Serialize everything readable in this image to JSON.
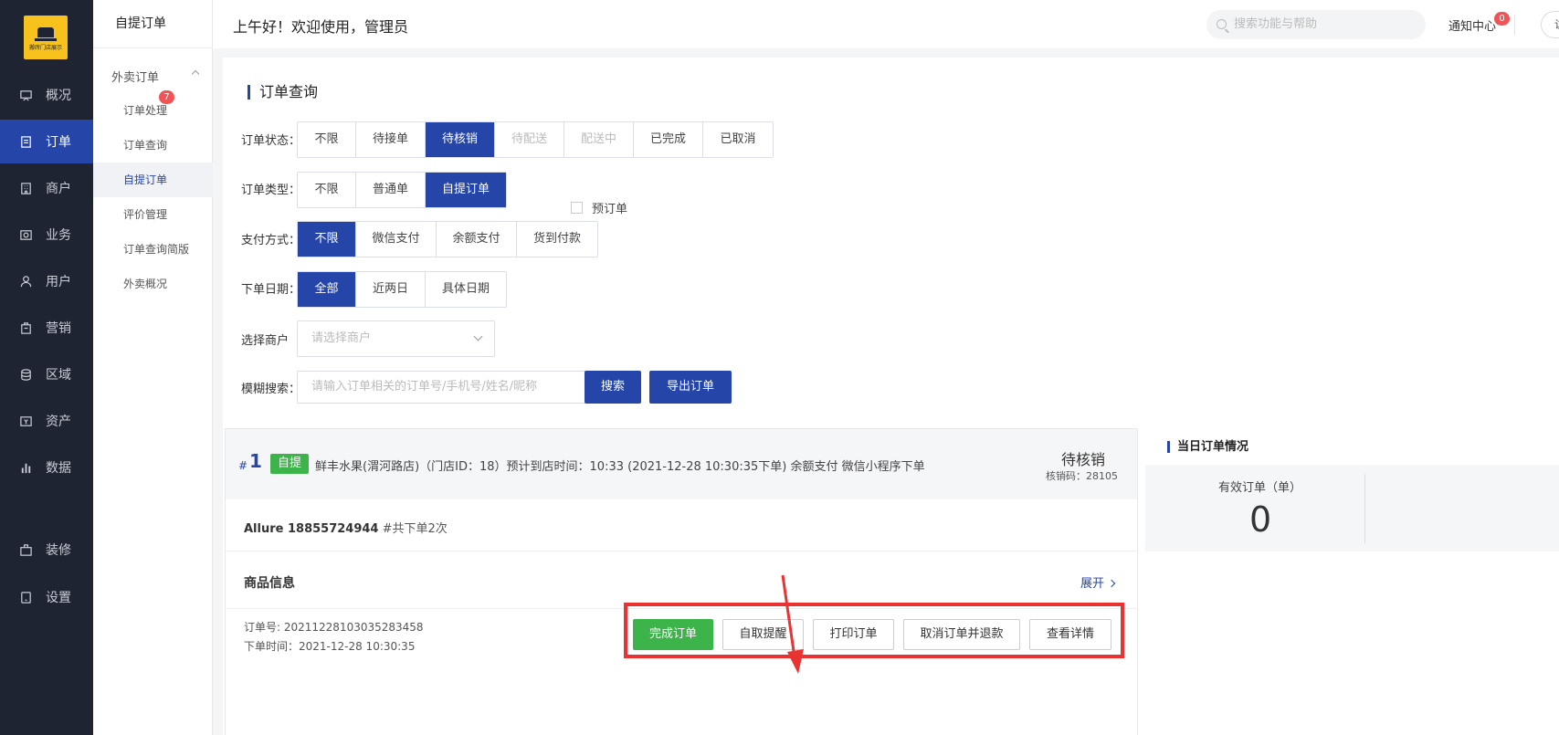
{
  "nav": {
    "logo_text": "搬砖门店展示",
    "items": [
      {
        "label": "概况",
        "icon": "dashboard-icon"
      },
      {
        "label": "订单",
        "icon": "order-icon"
      },
      {
        "label": "商户",
        "icon": "merchant-icon"
      },
      {
        "label": "业务",
        "icon": "business-icon"
      },
      {
        "label": "用户",
        "icon": "user-icon"
      },
      {
        "label": "营销",
        "icon": "marketing-icon"
      },
      {
        "label": "区域",
        "icon": "region-icon"
      },
      {
        "label": "资产",
        "icon": "asset-icon"
      },
      {
        "label": "数据",
        "icon": "data-icon"
      },
      {
        "label": "装修",
        "icon": "decorate-icon"
      },
      {
        "label": "设置",
        "icon": "settings-icon"
      }
    ]
  },
  "subnav": {
    "header": "自提订单",
    "group": "外卖订单",
    "badge": "7",
    "items": [
      "订单处理",
      "订单查询",
      "自提订单",
      "评价管理",
      "订单查询简版",
      "外卖概况"
    ]
  },
  "topbar": {
    "greeting": "上午好！欢迎使用，管理员",
    "search_placeholder": "搜索功能与帮助",
    "notice": "通知中心",
    "notice_count": "0",
    "visit": "访"
  },
  "query": {
    "title": "订单查询",
    "status_label": "订单状态：",
    "status_options": [
      "不限",
      "待接单",
      "待核销",
      "待配送",
      "配送中",
      "已完成",
      "已取消"
    ],
    "type_label": "订单类型：",
    "type_options": [
      "不限",
      "普通单",
      "自提订单"
    ],
    "preorder": "预订单",
    "pay_label": "支付方式：",
    "pay_options": [
      "不限",
      "微信支付",
      "余额支付",
      "货到付款"
    ],
    "date_label": "下单日期：",
    "date_options": [
      "全部",
      "近两日",
      "具体日期"
    ],
    "merchant_label": "选择商户",
    "merchant_placeholder": "请选择商户",
    "fuzzy_label": "模糊搜索：",
    "fuzzy_placeholder": "请输入订单相关的订单号/手机号/姓名/昵称",
    "search_btn": "搜索",
    "export_btn": "导出订单"
  },
  "order": {
    "hash": "#",
    "number": "1",
    "tag": "自提",
    "info": "鲜丰水果(渭河路店)（门店ID：18）预计到店时间：10:33   (2021-12-28 10:30:35下单)  余额支付   微信小程序下单",
    "status": "待核销",
    "code": "核销码：28105",
    "customer_name": "Allure 18855724944",
    "customer_count": " #共下单2次",
    "goods_title": "商品信息",
    "expand": "展开",
    "order_no": "订单号: 20211228103035283458",
    "order_time": "下单时间：2021-12-28 10:30:35",
    "actions": [
      "完成订单",
      "自取提醒",
      "打印订单",
      "取消订单并退款",
      "查看详情"
    ]
  },
  "today": {
    "title": "当日订单情况",
    "valid_label": "有效订单（单）",
    "valid_value": "0"
  }
}
